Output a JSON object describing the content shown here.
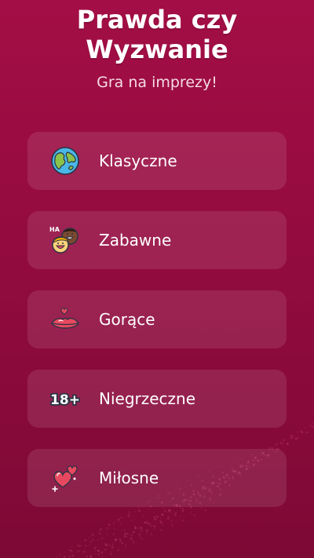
{
  "header": {
    "title_line1": "Prawda czy",
    "title_line2": "Wyzwanie",
    "subtitle": "Gra na imprezy!"
  },
  "categories": [
    {
      "label": "Klasyczne",
      "icon": "globe-icon"
    },
    {
      "label": "Zabawne",
      "icon": "laughing-faces-icon"
    },
    {
      "label": "Gorące",
      "icon": "kiss-lips-icon"
    },
    {
      "label": "Niegrzeczne",
      "icon": "adults-18-plus-icon"
    },
    {
      "label": "Miłosne",
      "icon": "hearts-icon"
    }
  ],
  "icon_text": {
    "ha": "HA",
    "adult_badge": "18+"
  },
  "colors": {
    "background_top": "#a30e45",
    "background_bottom": "#7d0935",
    "card_fill": "rgba(255,255,255,0.10)",
    "text": "#ffffff"
  }
}
